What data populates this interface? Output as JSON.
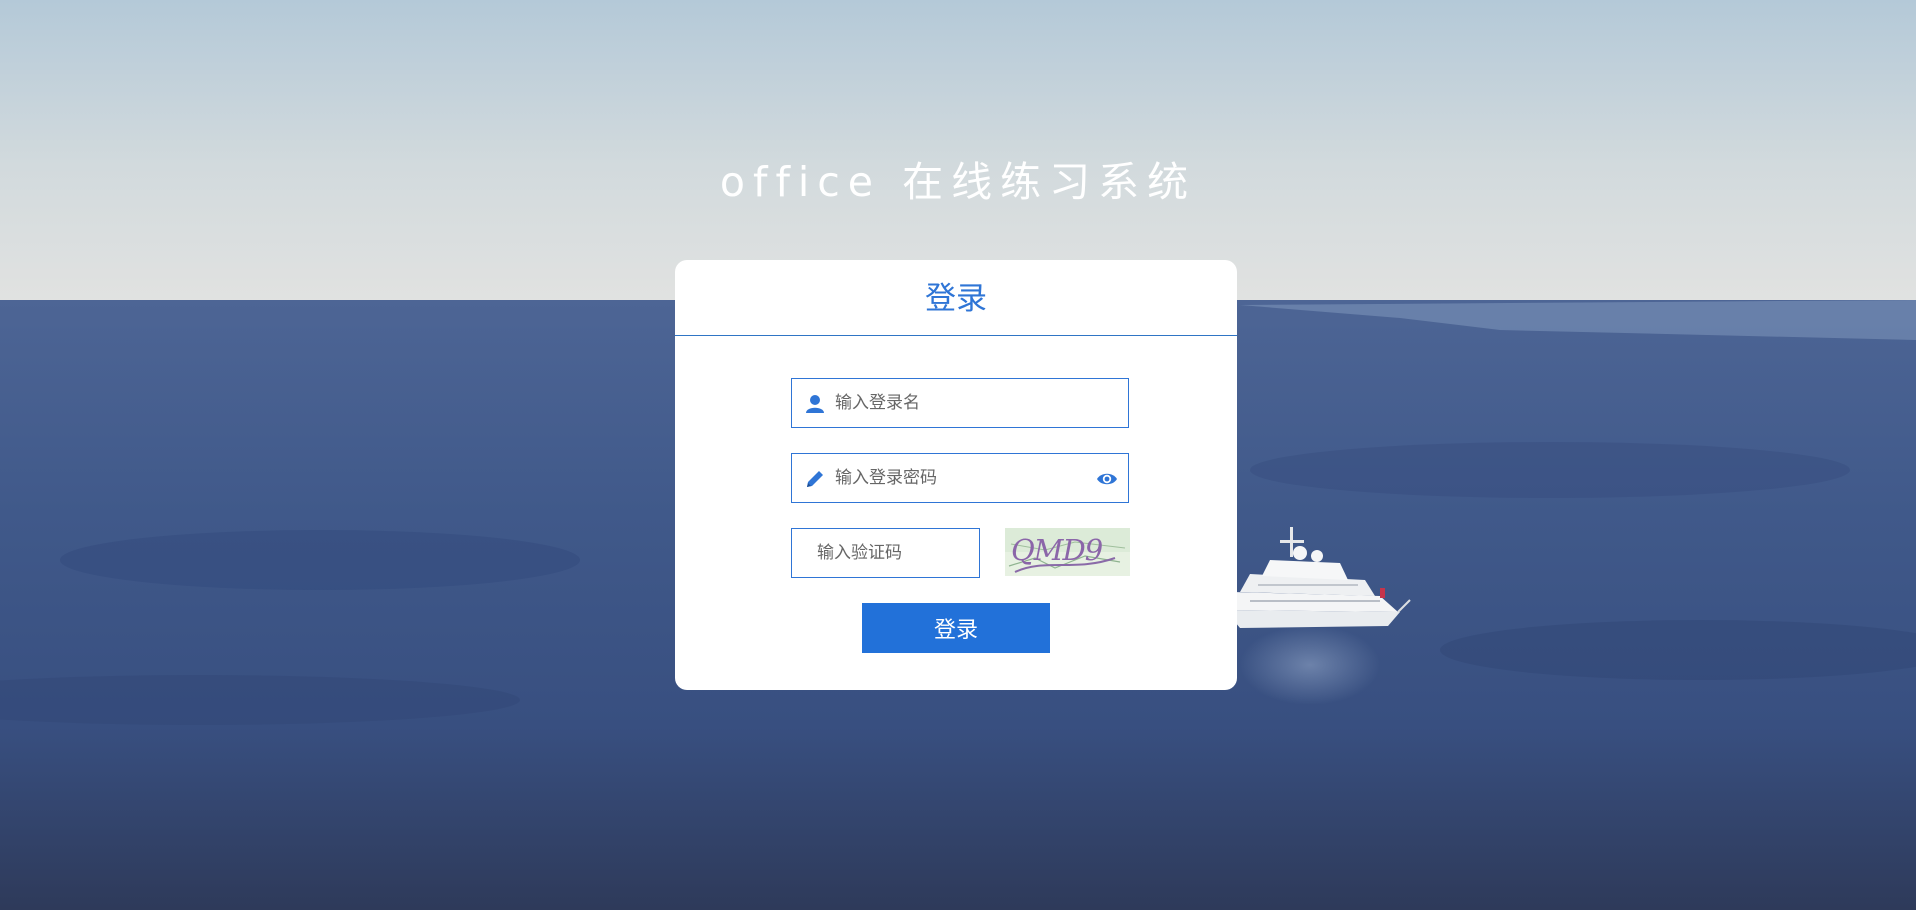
{
  "app": {
    "title": "office 在线练习系统"
  },
  "login_card": {
    "heading": "登录",
    "username_placeholder": "输入登录名",
    "password_placeholder": "输入登录密码",
    "captcha_placeholder": "输入验证码",
    "captcha_text": "QMD9",
    "submit_label": "登录"
  },
  "icons": {
    "username": "user-icon",
    "password": "pencil-icon",
    "toggle_password": "eye-icon"
  },
  "colors": {
    "accent": "#2271d9",
    "heading": "#2f75d6",
    "card_bg": "#ffffff",
    "title_text": "#ffffff"
  }
}
